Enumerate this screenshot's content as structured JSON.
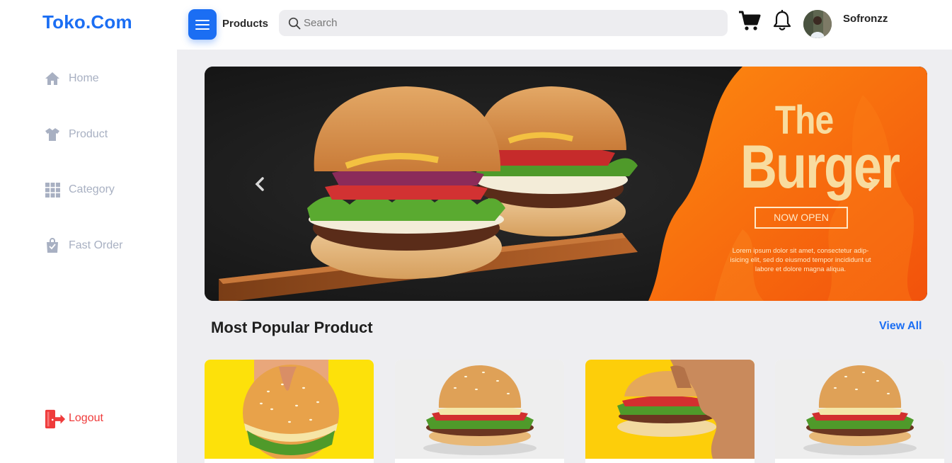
{
  "brand": {
    "name": "Toko.Com"
  },
  "sidebar": {
    "items": [
      {
        "label": "Home",
        "icon": "home-icon"
      },
      {
        "label": "Product",
        "icon": "shirt-icon"
      },
      {
        "label": "Category",
        "icon": "grid-icon"
      },
      {
        "label": "Fast Order",
        "icon": "shopping-bag-icon"
      }
    ],
    "logout_label": "Logout"
  },
  "header": {
    "page_label": "Products",
    "search_placeholder": "Search",
    "username": "Sofronzz"
  },
  "banner": {
    "title_line1": "The",
    "title_line2": "Burger",
    "cta": "NOW OPEN",
    "text": "Lorem ipsum dolor sit amet, consectetur adip-isicing elit, sed do eiusmod tempor incididunt ut labore et dolore magna aliqua."
  },
  "section": {
    "title": "Most Popular Product",
    "view_all": "View All"
  },
  "products": [
    {
      "image": "burger-held-on-yellow"
    },
    {
      "image": "burger-on-white"
    },
    {
      "image": "burger-held-on-yellow"
    },
    {
      "image": "burger-on-white"
    }
  ],
  "colors": {
    "accent": "#1b6ef3",
    "logout": "#ef3b3b",
    "banner_orange": "#f76a0c",
    "main_bg": "#eeeef1",
    "nav_text": "#a8b0c2"
  }
}
